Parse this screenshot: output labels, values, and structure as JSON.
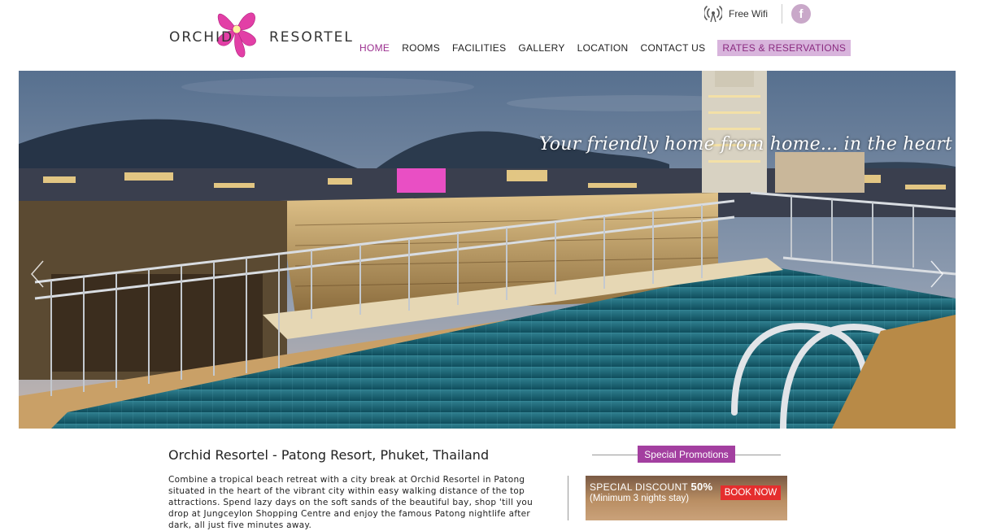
{
  "brand": {
    "word1": "ORCHID",
    "word2": "RESORTEL",
    "colors": {
      "accent": "#9b2f8f",
      "nav_highlight": "#d8b4dc",
      "promo": "#a33fa0",
      "book": "#e52e2e"
    }
  },
  "utility": {
    "wifi_icon": "wifi-icon",
    "wifi_label": "Free Wifi",
    "facebook_icon": "facebook-icon",
    "facebook_glyph": "f"
  },
  "nav": {
    "home": "HOME",
    "rooms": "ROOMS",
    "facilities": "FACILITIES",
    "gallery": "GALLERY",
    "location": "LOCATION",
    "contact": "CONTACT US",
    "rates": "RATES & RESERVATIONS",
    "active": "HOME"
  },
  "hero": {
    "tagline": "Your friendly home from home... in the heart of patong",
    "prev_icon": "chevron-left-icon",
    "next_icon": "chevron-right-icon"
  },
  "content": {
    "title": "Orchid Resortel - Patong Resort, Phuket, Thailand",
    "intro": "Combine a tropical beach retreat with a city break at Orchid Resortel in Patong situated in the heart of the vibrant city within easy walking distance of the top attractions. Spend lazy days on the soft sands of the beautiful bay, shop 'till you drop at Jungceylon Shopping Centre and enjoy the famous Patong nightlife after dark, all just five minutes away."
  },
  "promotions": {
    "heading": "Special Promotions",
    "banner_line1_prefix": "SPECIAL DISCOUNT ",
    "banner_line1_value": "50%",
    "banner_line2": "(Minimum 3 nights stay)",
    "book_now": "BOOK NOW"
  }
}
